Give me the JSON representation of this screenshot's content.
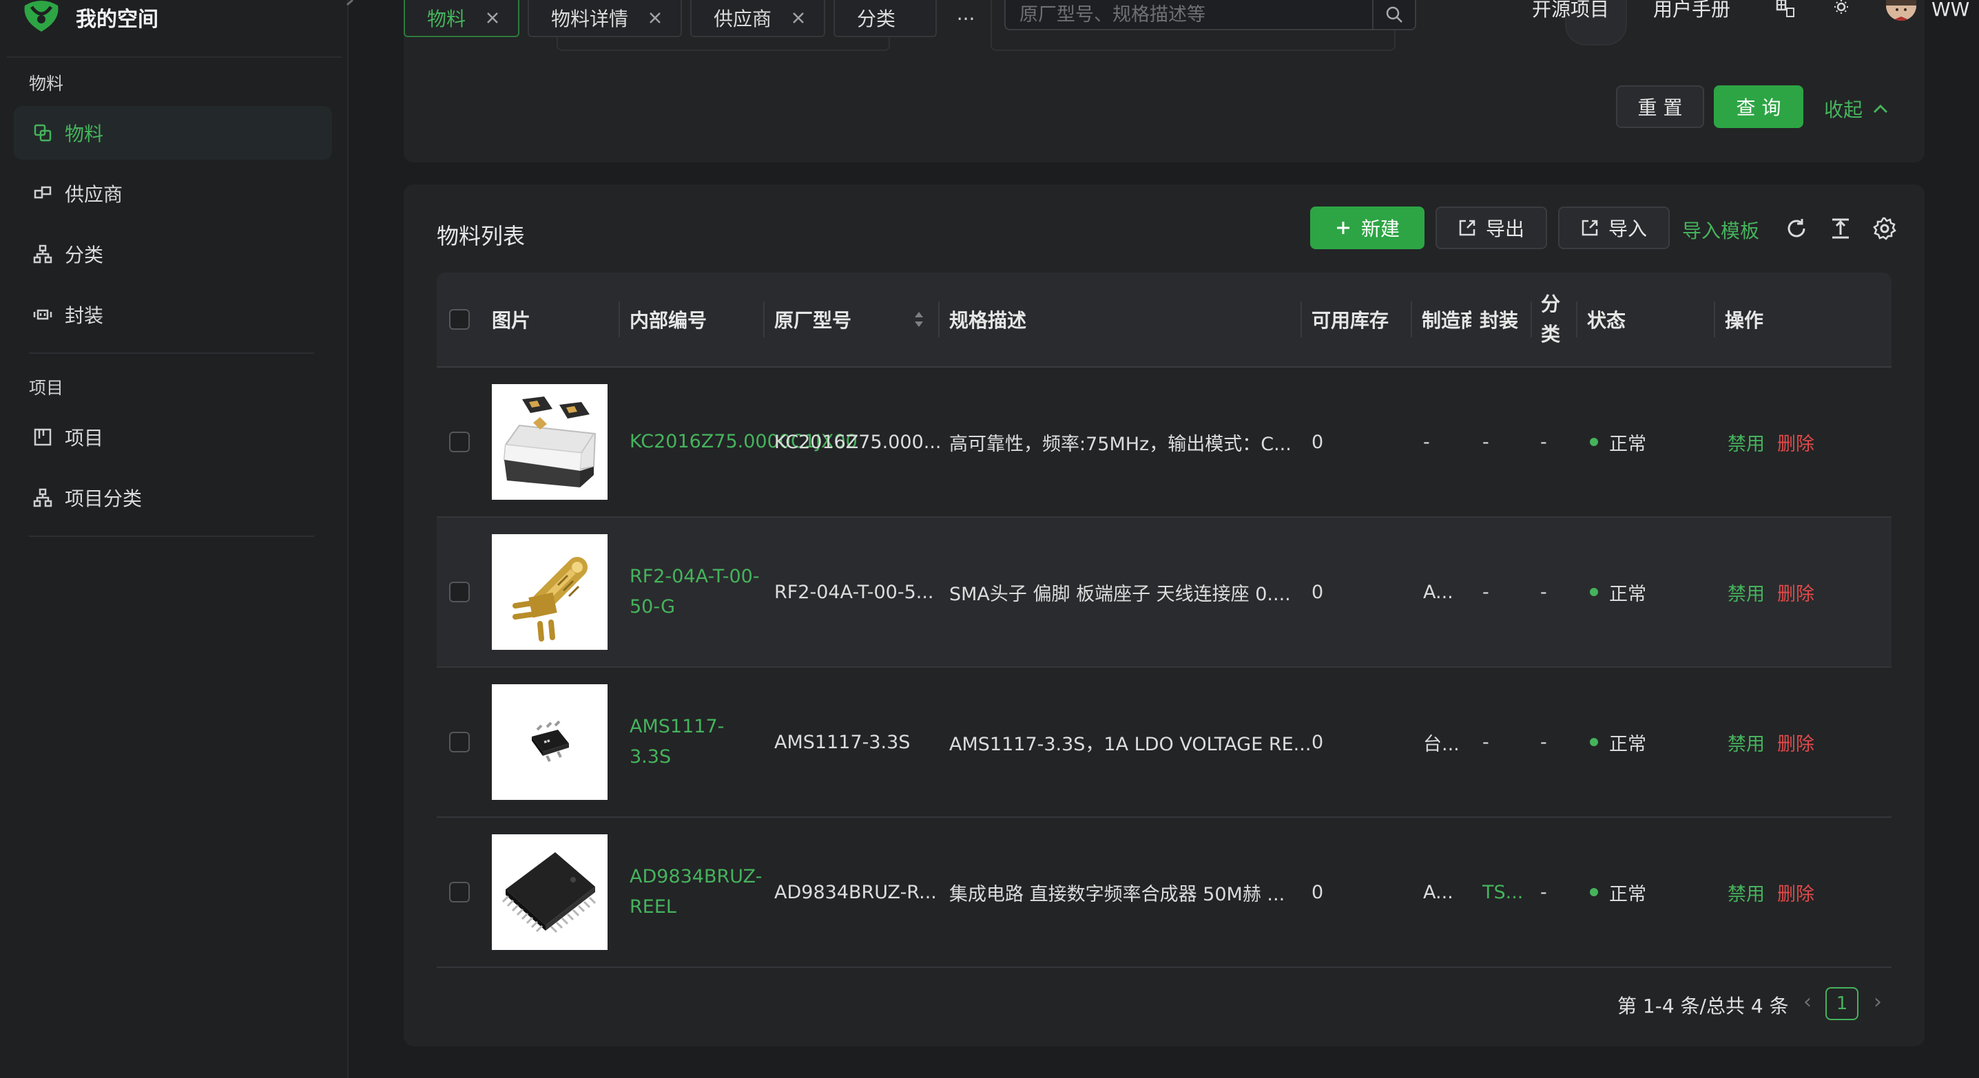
{
  "app": {
    "title": "我的空间"
  },
  "sidebar": {
    "groups": [
      {
        "label": "物料",
        "items": [
          {
            "label": "物料",
            "active": true
          },
          {
            "label": "供应商"
          },
          {
            "label": "分类"
          },
          {
            "label": "封装"
          }
        ]
      },
      {
        "label": "项目",
        "items": [
          {
            "label": "项目"
          },
          {
            "label": "项目分类"
          }
        ]
      }
    ]
  },
  "tabs": [
    {
      "label": "物料",
      "active": true
    },
    {
      "label": "物料详情"
    },
    {
      "label": "供应商"
    },
    {
      "label": "分类"
    }
  ],
  "tab_more": "···",
  "search": {
    "placeholder": "原厂型号、规格描述等",
    "value": ""
  },
  "header": {
    "open_source": "开源项目",
    "manual": "用户手册",
    "user_name": "WW"
  },
  "filters": {
    "reset": "重 置",
    "query": "查 询",
    "collapse": "收起"
  },
  "list": {
    "title": "物料列表",
    "toolbar": {
      "new": "新建",
      "export": "导出",
      "import": "导入",
      "import_template": "导入模板"
    },
    "columns": {
      "image": "图片",
      "internal_code": "内部编号",
      "mfr_part": "原厂型号",
      "spec": "规格描述",
      "stock": "可用库存",
      "manufacturer": "制造商",
      "package": "封装",
      "category": "分类",
      "status": "状态",
      "actions": "操作"
    },
    "rows": [
      {
        "code": "KC2016Z75.0000C1JX00",
        "mfr_part": "KC2016Z75.000...",
        "spec": "高可靠性，频率:75MHz，输出模式：C...",
        "stock": "0",
        "manufacturer": "-",
        "package": "-",
        "category": "-",
        "status": "正常",
        "disable": "禁用",
        "delete": "删除",
        "thumb": "crystal-oscillator"
      },
      {
        "code": "RF2-04A-T-00-50-G",
        "mfr_part": "RF2-04A-T-00-5...",
        "spec": "SMA头子 偏脚 板端座子 天线连接座 0....",
        "stock": "0",
        "manufacturer": "A...",
        "package": "-",
        "category": "-",
        "status": "正常",
        "disable": "禁用",
        "delete": "删除",
        "thumb": "sma-connector"
      },
      {
        "code": "AMS1117-3.3S",
        "mfr_part": "AMS1117-3.3S",
        "spec": "AMS1117-3.3S，1A LDO VOLTAGE RE...",
        "stock": "0",
        "manufacturer": "台...",
        "package": "-",
        "category": "-",
        "status": "正常",
        "disable": "禁用",
        "delete": "删除",
        "thumb": "sot223-regulator"
      },
      {
        "code": "AD9834BRUZ-REEL",
        "mfr_part": "AD9834BRUZ-R...",
        "spec": "集成电路 直接数字频率合成器 50M赫 ...",
        "stock": "0",
        "manufacturer": "A...",
        "package": "TS...",
        "category": "-",
        "status": "正常",
        "disable": "禁用",
        "delete": "删除",
        "thumb": "tssop-ic"
      }
    ],
    "pagination": {
      "summary": "第 1-4 条/总共 4 条",
      "current": "1"
    }
  },
  "colors": {
    "accent": "#2da544",
    "danger": "#e04a4a",
    "bg": "#1c1d1f",
    "card": "#232426"
  }
}
